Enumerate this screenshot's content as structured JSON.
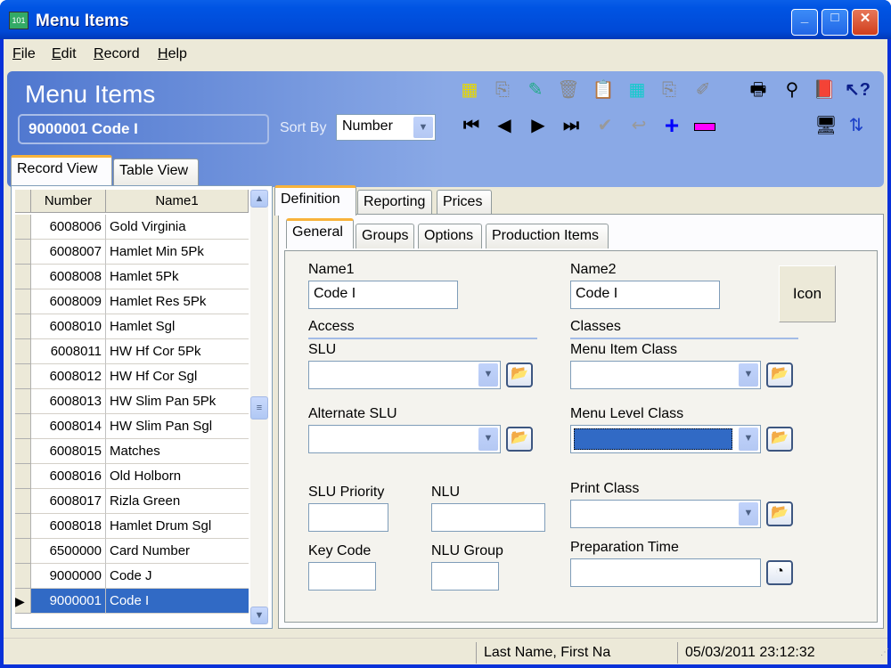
{
  "window": {
    "title": "Menu Items",
    "app_icon": "app-icon"
  },
  "window_controls": {
    "minimize": "_",
    "maximize": "□",
    "close": "✕"
  },
  "menubar": [
    {
      "label": "File",
      "accel": "F",
      "rest": "ile"
    },
    {
      "label": "Edit",
      "accel": "E",
      "rest": "dit"
    },
    {
      "label": "Record",
      "accel": "R",
      "rest": "ecord"
    },
    {
      "label": "Help",
      "accel": "H",
      "rest": "elp"
    }
  ],
  "banner": {
    "title": "Menu Items",
    "current_record": "9000001   Code I",
    "sort_by_label": "Sort By",
    "sort_by_value": "Number"
  },
  "toolbar": {
    "top_icons": [
      "new-record-icon",
      "copy-record-icon",
      "edit-records-icon",
      "delete-icon",
      "paste-icon",
      "new-record-cyan-icon",
      "copy-record-2-icon",
      "wand-icon"
    ],
    "nav_icons": [
      "first-record-icon",
      "previous-record-icon",
      "next-record-icon",
      "last-record-icon",
      "confirm-icon",
      "undo-icon",
      "add-icon",
      "remove-icon"
    ],
    "right_icons": [
      "print-icon",
      "find-icon",
      "help-book-icon",
      "context-help-icon"
    ],
    "bottom_right_icons": [
      "display-icon",
      "sync-icon"
    ]
  },
  "view_tabs": [
    {
      "label": "Record View",
      "active": true
    },
    {
      "label": "Table View",
      "active": false
    }
  ],
  "grid": {
    "columns": [
      "Number",
      "Name1"
    ],
    "rows": [
      {
        "number": "6008006",
        "name": "Gold Virginia"
      },
      {
        "number": "6008007",
        "name": "Hamlet Min 5Pk"
      },
      {
        "number": "6008008",
        "name": "Hamlet 5Pk"
      },
      {
        "number": "6008009",
        "name": "Hamlet Res 5Pk"
      },
      {
        "number": "6008010",
        "name": "Hamlet Sgl"
      },
      {
        "number": "6008011",
        "name": "HW Hf Cor 5Pk"
      },
      {
        "number": "6008012",
        "name": "HW Hf Cor Sgl"
      },
      {
        "number": "6008013",
        "name": "HW Slim Pan 5Pk"
      },
      {
        "number": "6008014",
        "name": "HW Slim Pan Sgl"
      },
      {
        "number": "6008015",
        "name": "Matches"
      },
      {
        "number": "6008016",
        "name": "Old Holborn"
      },
      {
        "number": "6008017",
        "name": "Rizla Green"
      },
      {
        "number": "6008018",
        "name": "Hamlet Drum Sgl"
      },
      {
        "number": "6500000",
        "name": "Card Number"
      },
      {
        "number": "9000000",
        "name": "Code J"
      },
      {
        "number": "9000001",
        "name": "Code I",
        "selected": true
      }
    ]
  },
  "detail_tabs": [
    {
      "label": "Definition",
      "active": true
    },
    {
      "label": "Reporting"
    },
    {
      "label": "Prices"
    }
  ],
  "sub_tabs": [
    {
      "label": "General",
      "active": true
    },
    {
      "label": "Groups"
    },
    {
      "label": "Options"
    },
    {
      "label": "Production Items"
    }
  ],
  "form": {
    "name1_label": "Name1",
    "name1_value": "Code I",
    "name2_label": "Name2",
    "name2_value": "Code I",
    "icon_button": "Icon",
    "access_header": "Access",
    "classes_header": "Classes",
    "slu_label": "SLU",
    "slu_value": "",
    "alt_slu_label": "Alternate SLU",
    "alt_slu_value": "",
    "menu_item_class_label": "Menu Item Class",
    "menu_item_class_value": "",
    "menu_level_class_label": "Menu Level Class",
    "menu_level_class_value": "",
    "slu_priority_label": "SLU Priority",
    "slu_priority_value": "",
    "nlu_label": "NLU",
    "nlu_value": "",
    "key_code_label": "Key Code",
    "key_code_value": "",
    "nlu_group_label": "NLU Group",
    "nlu_group_value": "",
    "print_class_label": "Print Class",
    "print_class_value": "",
    "prep_time_label": "Preparation Time",
    "prep_time_value": ""
  },
  "status_bar": {
    "user": "Last Name, First Na",
    "datetime": "05/03/2011 23:12:32"
  }
}
